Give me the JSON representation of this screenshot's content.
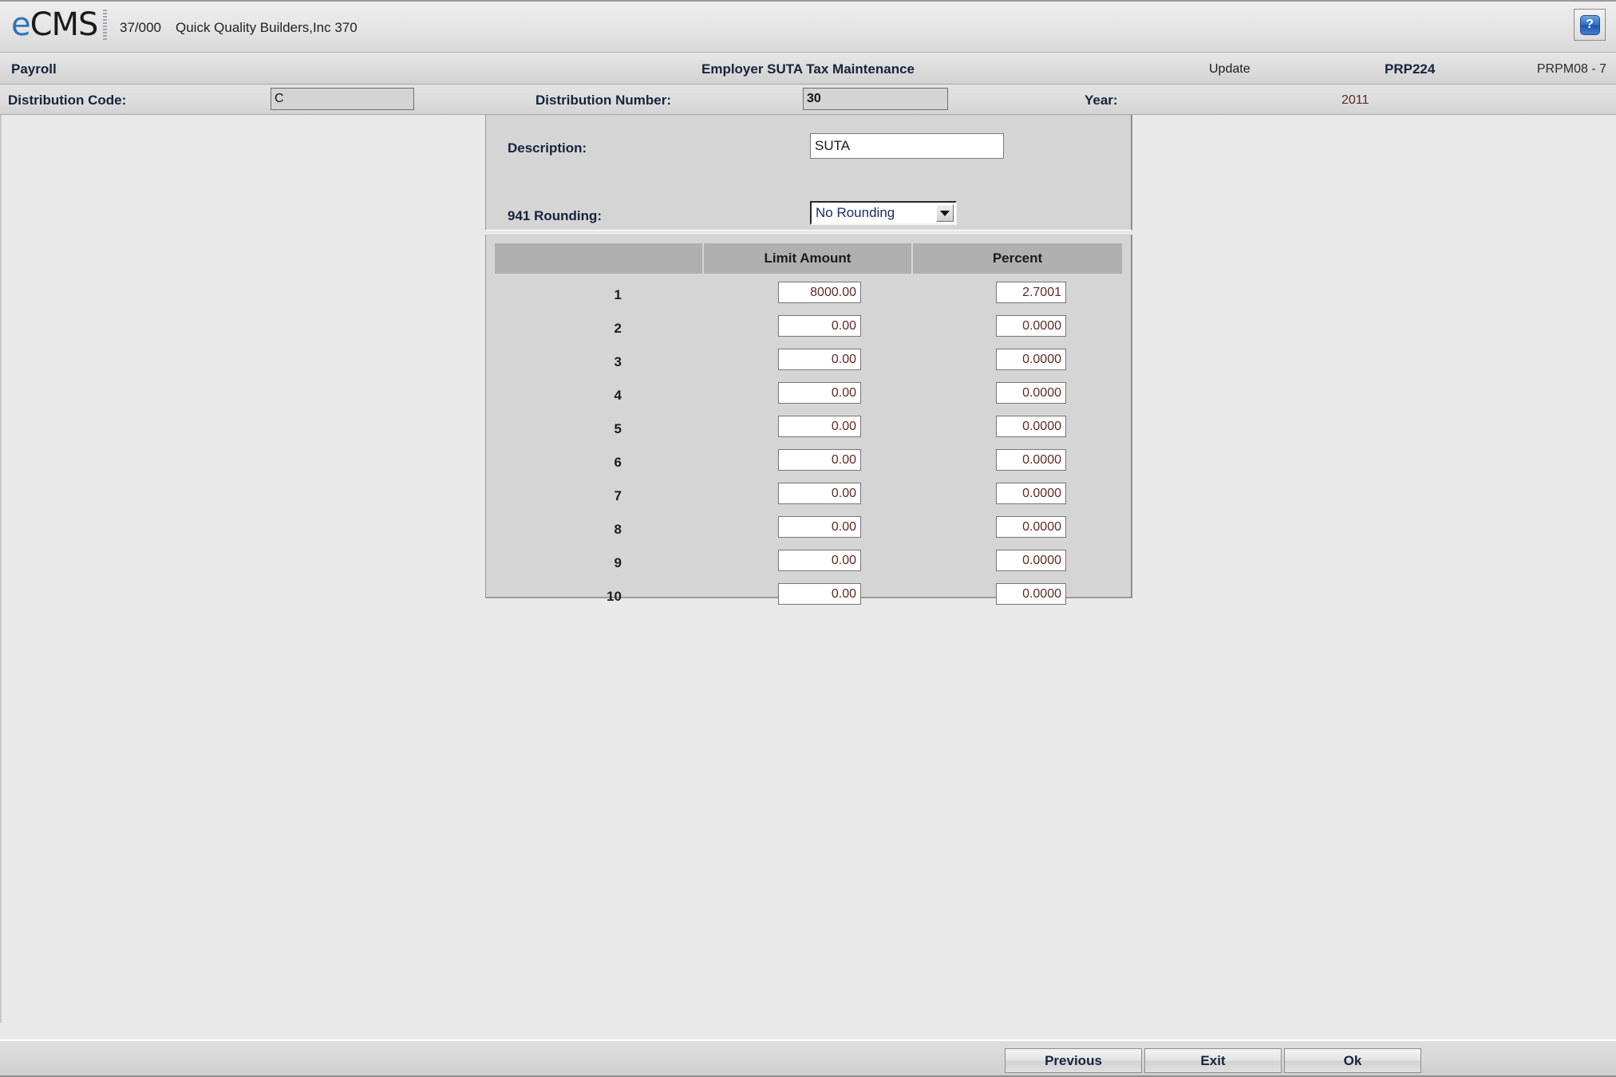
{
  "brand": {
    "logo_e": "e",
    "logo_rest": "CMS",
    "company_code": "37/000",
    "company_name": "Quick Quality Builders,Inc 370",
    "help_glyph": "?"
  },
  "module_bar": {
    "module": "Payroll",
    "title": "Employer SUTA Tax Maintenance",
    "mode": "Update",
    "program": "PRP224",
    "screen": "PRPM08 - 7"
  },
  "key_bar": {
    "distribution_code_label": "Distribution Code:",
    "distribution_code_value": "C",
    "distribution_number_label": "Distribution Number:",
    "distribution_number_value": "30",
    "year_label": "Year:",
    "year_value": "2011"
  },
  "form": {
    "description_label": "Description:",
    "description_value": "SUTA",
    "description_placeholder": "",
    "rounding_label": "941 Rounding:",
    "rounding_value": "No Rounding",
    "rounding_options": [
      "No Rounding"
    ]
  },
  "grid": {
    "headers": {
      "number": "",
      "limit_amount": "Limit Amount",
      "percent": "Percent"
    },
    "rows": [
      {
        "num": "1",
        "limit": "8000.00",
        "percent": "2.7001"
      },
      {
        "num": "2",
        "limit": "0.00",
        "percent": "0.0000"
      },
      {
        "num": "3",
        "limit": "0.00",
        "percent": "0.0000"
      },
      {
        "num": "4",
        "limit": "0.00",
        "percent": "0.0000"
      },
      {
        "num": "5",
        "limit": "0.00",
        "percent": "0.0000"
      },
      {
        "num": "6",
        "limit": "0.00",
        "percent": "0.0000"
      },
      {
        "num": "7",
        "limit": "0.00",
        "percent": "0.0000"
      },
      {
        "num": "8",
        "limit": "0.00",
        "percent": "0.0000"
      },
      {
        "num": "9",
        "limit": "0.00",
        "percent": "0.0000"
      },
      {
        "num": "10",
        "limit": "0.00",
        "percent": "0.0000"
      }
    ]
  },
  "footer": {
    "previous": "Previous",
    "exit": "Exit",
    "ok": "Ok"
  },
  "colors": {
    "accent_blue": "#2f74b5",
    "heading_navy": "#16243c",
    "value_maroon": "#5d2a24",
    "combo_text": "#1d2b66",
    "panel_gray": "#d5d5d5",
    "header_cell_gray": "#b0b0b0",
    "page_background": "#e9e9e9"
  }
}
